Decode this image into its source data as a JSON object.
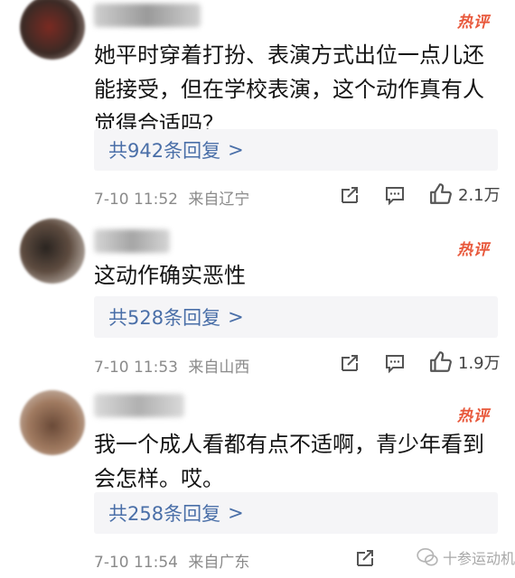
{
  "hot_tag": "热评",
  "comments": [
    {
      "text": "她平时穿着打扮、表演方式出位一点儿还能接受，但在学校表演，这个动作真有人觉得合适吗？",
      "reply_label": "共942条回复",
      "reply_chevron": ">",
      "timestamp": "7-10 11:52",
      "location": "来自辽宁",
      "likes": "2.1万",
      "avatar_color": "#5a3a2e"
    },
    {
      "text": "这动作确实恶性",
      "reply_label": "共528条回复",
      "reply_chevron": ">",
      "timestamp": "7-10 11:53",
      "location": "来自山西",
      "likes": "1.9万",
      "avatar_color": "#4a4038"
    },
    {
      "text": "我一个成人看都有点不适啊，青少年看到会怎样。哎。",
      "reply_label": "共258条回复",
      "reply_chevron": ">",
      "timestamp": "7-10 11:54",
      "location": "来自广东",
      "likes": "",
      "avatar_color": "#8a6048"
    }
  ],
  "watermark": {
    "text": "十参运动机"
  },
  "colors": {
    "accent_link": "#4a6fa8",
    "hot_tag": "#e8583b",
    "reply_bg": "#f5f5f7",
    "meta_text": "#8a8a8a"
  },
  "icons": {
    "share": "share-icon",
    "comment": "comment-icon",
    "like": "thumbs-up-icon",
    "watermark_logo": "wechat-logo-icon"
  }
}
